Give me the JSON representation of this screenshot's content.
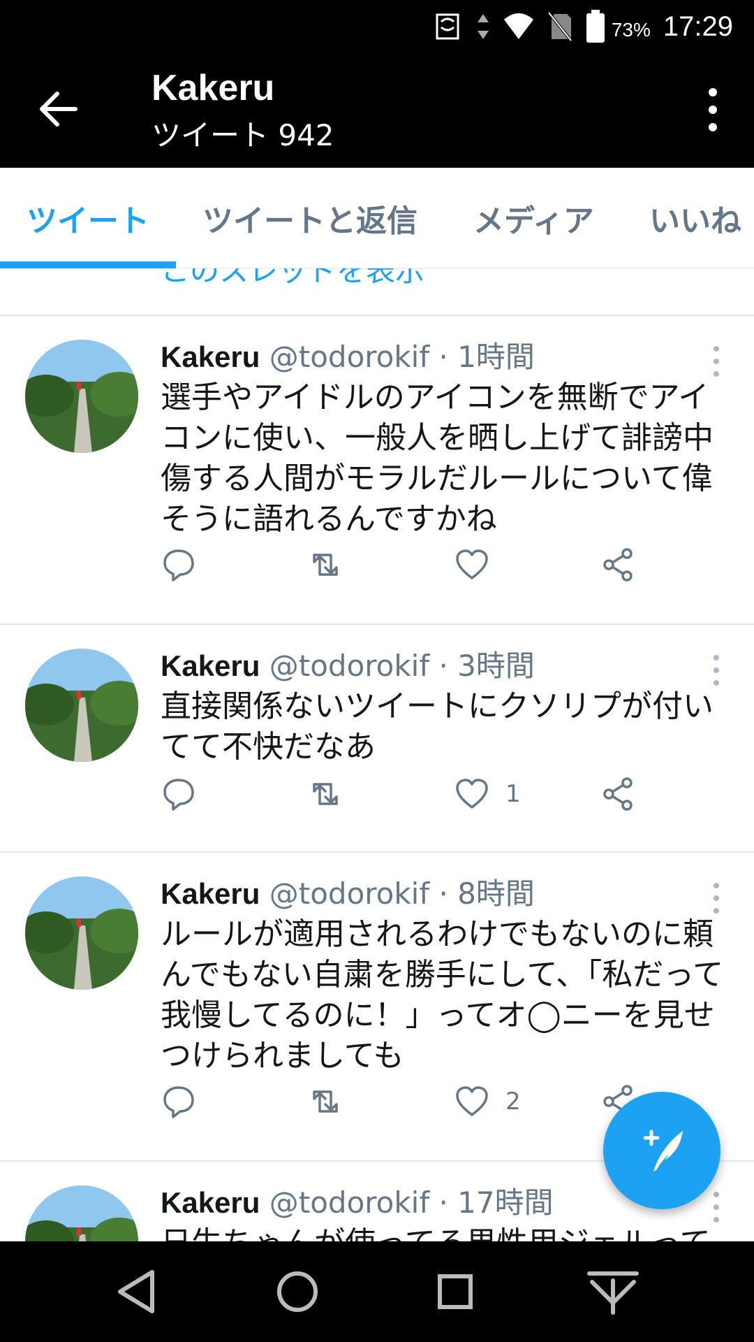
{
  "status_bar": {
    "battery_percent": "73%",
    "time": "17:29",
    "icons": [
      "nfc-icon",
      "data-arrows-icon",
      "wifi-icon",
      "no-sim-icon",
      "battery-icon"
    ]
  },
  "app_bar": {
    "title": "Kakeru",
    "subtitle": "ツイート 942",
    "back_icon": "arrow-left-icon",
    "more_icon": "more-vertical-icon"
  },
  "tabs": [
    {
      "label": "ツイート",
      "active": true
    },
    {
      "label": "ツイートと返信",
      "active": false
    },
    {
      "label": "メディア",
      "active": false
    },
    {
      "label": "いいね",
      "active": false
    }
  ],
  "thread_link": "このスレッドを表示",
  "tweets": [
    {
      "name": "Kakeru",
      "handle": "@todorokif",
      "dot": "·",
      "time": "1時間",
      "text": "選手やアイドルのアイコンを無断でアイコンに使い、一般人を晒し上げて誹謗中傷する人間がモラルだルールについて偉そうに語れるんですかね",
      "likes": ""
    },
    {
      "name": "Kakeru",
      "handle": "@todorokif",
      "dot": "·",
      "time": "3時間",
      "text": "直接関係ないツイートにクソリプが付いてて不快だなあ",
      "likes": "1"
    },
    {
      "name": "Kakeru",
      "handle": "@todorokif",
      "dot": "·",
      "time": "8時間",
      "text": "ルールが適用されるわけでもないのに頼んでもない自粛を勝手にして、「私だって我慢してるのに！」ってオ◯ニーを見せつけられましても",
      "likes": "2"
    },
    {
      "name": "Kakeru",
      "handle": "@todorokif",
      "dot": "·",
      "time": "17時間",
      "text": "日生ちゃんが使ってる男性用ジェルって",
      "likes": ""
    }
  ],
  "colors": {
    "accent": "#1da1f2",
    "secondary_text": "#657786",
    "divider": "#e1e8ed",
    "bar_background": "#000000"
  },
  "nav_bar": {
    "icons": [
      "back-triangle-icon",
      "home-circle-icon",
      "recents-square-icon",
      "notification-pull-icon"
    ]
  },
  "fab": {
    "icon": "compose-tweet-icon"
  }
}
